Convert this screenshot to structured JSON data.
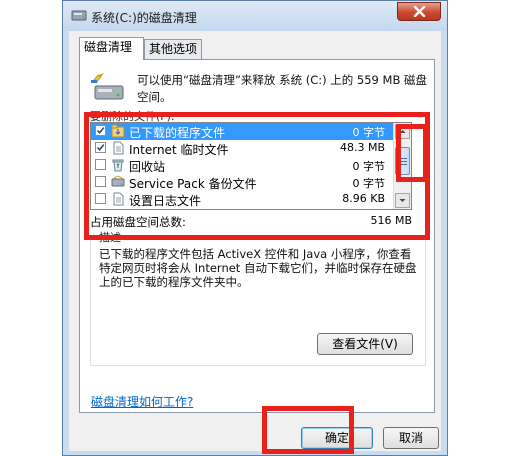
{
  "window": {
    "title": "系统(C:)的磁盘清理"
  },
  "tabs": [
    {
      "label": "磁盘清理",
      "active": true
    },
    {
      "label": "其他选项",
      "active": false
    }
  ],
  "summary": {
    "text": "可以使用“磁盘清理”来释放 系统 (C:) 上的 559 MB 磁盘空间。"
  },
  "files_label": "要删除的文件(F):",
  "file_list": [
    {
      "name": "已下载的程序文件",
      "size": "0 字节",
      "checked": true,
      "selected": true,
      "icon": "folder-download-icon"
    },
    {
      "name": "Internet 临时文件",
      "size": "48.3 MB",
      "checked": true,
      "selected": false,
      "icon": "document-icon"
    },
    {
      "name": "回收站",
      "size": "0 字节",
      "checked": false,
      "selected": false,
      "icon": "recycle-bin-icon"
    },
    {
      "name": "Service Pack 备份文件",
      "size": "0 字节",
      "checked": false,
      "selected": false,
      "icon": "backup-icon"
    },
    {
      "name": "设置日志文件",
      "size": "8.96 KB",
      "checked": false,
      "selected": false,
      "icon": "document-icon"
    }
  ],
  "total": {
    "label": "占用磁盘空间总数:",
    "value": "516 MB"
  },
  "description": {
    "title": "描述",
    "text": "已下载的程序文件包括 ActiveX 控件和 Java 小程序，你查看特定网页时将会从 Internet 自动下载它们，并临时保存在硬盘上的已下载的程序文件夹中。"
  },
  "buttons": {
    "view_files": "查看文件(V)",
    "ok": "确定",
    "cancel": "取消"
  },
  "help_link": "磁盘清理如何工作?",
  "colors": {
    "selection": "#3399ff",
    "highlight": "#e8211c",
    "link": "#0066cc"
  }
}
